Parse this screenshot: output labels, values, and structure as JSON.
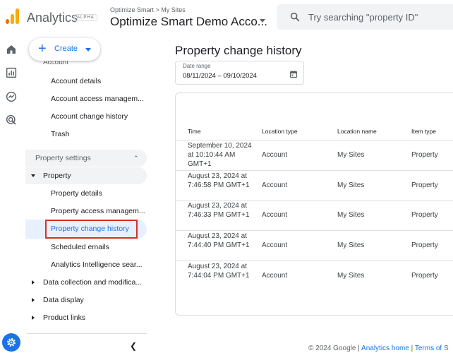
{
  "header": {
    "app_title": "Analytics",
    "alpha_badge": "ALPHA",
    "breadcrumb": "Optimize Smart > My Sites",
    "account_name": "Optimize Smart Demo Acco...",
    "search_placeholder": "Try searching \"property ID\""
  },
  "nav": {
    "create_label": "Create",
    "account_header_partial": "Account",
    "account_items": [
      "Account details",
      "Account access managem...",
      "Account change history",
      "Trash"
    ],
    "property_settings_label": "Property settings",
    "property_label": "Property",
    "property_items": [
      "Property details",
      "Property access managem...",
      "Property change history",
      "Scheduled emails",
      "Analytics Intelligence sear..."
    ],
    "collapsed_groups": [
      "Data collection and modifica...",
      "Data display",
      "Product links"
    ]
  },
  "main": {
    "page_title": "Property change history",
    "date_range_label": "Date range",
    "date_range_value": "08/11/2024 – 09/10/2024",
    "columns": [
      "Time",
      "Location type",
      "Location name",
      "Item type"
    ],
    "rows": [
      {
        "time": "September 10, 2024 at 10:10:44 AM GMT+1",
        "location_type": "Account",
        "location_name": "My Sites",
        "item_type": "Property"
      },
      {
        "time": "August 23, 2024 at 7:46:58 PM GMT+1",
        "location_type": "Account",
        "location_name": "My Sites",
        "item_type": "Property"
      },
      {
        "time": "August 23, 2024 at 7:46:33 PM GMT+1",
        "location_type": "Account",
        "location_name": "My Sites",
        "item_type": "Property"
      },
      {
        "time": "August 23, 2024 at 7:44:40 PM GMT+1",
        "location_type": "Account",
        "location_name": "My Sites",
        "item_type": "Property"
      },
      {
        "time": "August 23, 2024 at 7:44:04 PM GMT+1",
        "location_type": "Account",
        "location_name": "My Sites",
        "item_type": "Property"
      }
    ]
  },
  "footer": {
    "copyright": "© 2024 Google |",
    "home_link": "Analytics home",
    "separator": "|",
    "terms_link": "Terms of S"
  },
  "colors": {
    "accent": "#1a73e8",
    "highlight_border": "#d93025",
    "logo_orange": "#f9ab00",
    "logo_dark_orange": "#e37400"
  },
  "icons": [
    "analytics-logo-icon",
    "search-icon",
    "home-icon",
    "reports-icon",
    "explore-icon",
    "advertising-icon",
    "settings-gear-icon",
    "calendar-icon",
    "collapse-left-icon"
  ]
}
